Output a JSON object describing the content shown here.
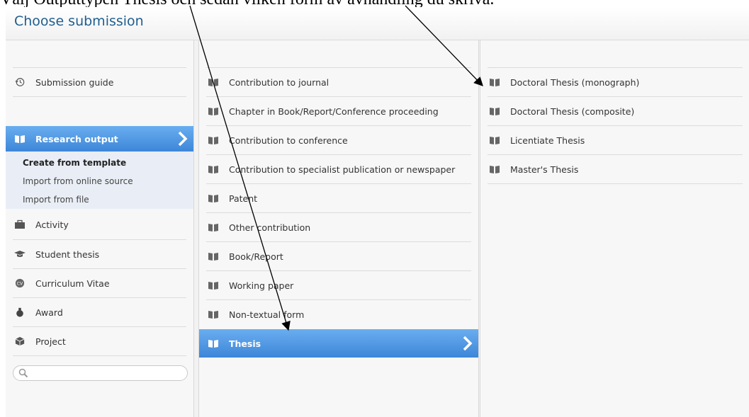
{
  "annotation": "Välj Outputtypen Thesis och sedan vilken form av avhandling du skriva.",
  "window": {
    "title": "Choose submission"
  },
  "col1": {
    "submission_guide": "Submission guide",
    "research_output": "Research output",
    "sub_items": [
      "Create from template",
      "Import from online source",
      "Import from file"
    ],
    "items": [
      {
        "label": "Activity",
        "icon": "briefcase-icon"
      },
      {
        "label": "Student thesis",
        "icon": "graduation-cap-icon"
      },
      {
        "label": "Curriculum Vitae",
        "icon": "cv-icon"
      },
      {
        "label": "Award",
        "icon": "award-icon"
      },
      {
        "label": "Project",
        "icon": "cube-icon"
      }
    ],
    "search_placeholder": ""
  },
  "col2": {
    "items": [
      "Contribution to journal",
      "Chapter in Book/Report/Conference proceeding",
      "Contribution to conference",
      "Contribution to specialist publication or newspaper",
      "Patent",
      "Other contribution",
      "Book/Report",
      "Working paper",
      "Non-textual form"
    ],
    "selected": "Thesis"
  },
  "col3": {
    "items": [
      "Doctoral Thesis (monograph)",
      "Doctoral Thesis (composite)",
      "Licentiate Thesis",
      "Master's Thesis"
    ]
  },
  "colors": {
    "accent_top": "#6aaef0",
    "accent_bottom": "#3d86d8",
    "title": "#1f5e8f"
  }
}
